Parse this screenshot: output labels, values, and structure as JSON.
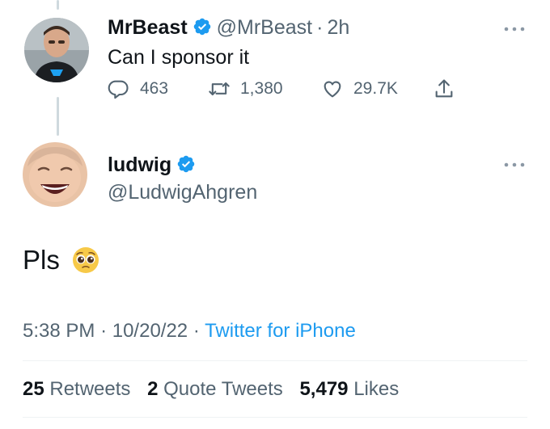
{
  "reply_to": {
    "display_name": "MrBeast",
    "handle": "@MrBeast",
    "separator": "·",
    "time": "2h",
    "text": "Can I sponsor it",
    "stats": {
      "replies": "463",
      "retweets": "1,380",
      "likes": "29.7K"
    },
    "verified": true
  },
  "tweet": {
    "display_name": "ludwig",
    "handle": "@LudwigAhgren",
    "text": "Pls",
    "emoji": "pleading-face",
    "time": "5:38 PM",
    "sep1": "·",
    "date": "10/20/22",
    "sep2": "·",
    "source": "Twitter for iPhone",
    "verified": true,
    "engagement": {
      "retweets_count": "25",
      "retweets_label": "Retweets",
      "quote_count": "2",
      "quote_label": "Quote Tweets",
      "likes_count": "5,479",
      "likes_label": "Likes"
    }
  },
  "colors": {
    "verified_blue": "#1d9bf0",
    "secondary_text": "#536471",
    "primary_text": "#0f1419",
    "link": "#1d9bf0"
  },
  "icons": [
    "reply-icon",
    "retweet-icon",
    "like-icon",
    "share-icon",
    "more-icon",
    "verified-badge-icon"
  ]
}
